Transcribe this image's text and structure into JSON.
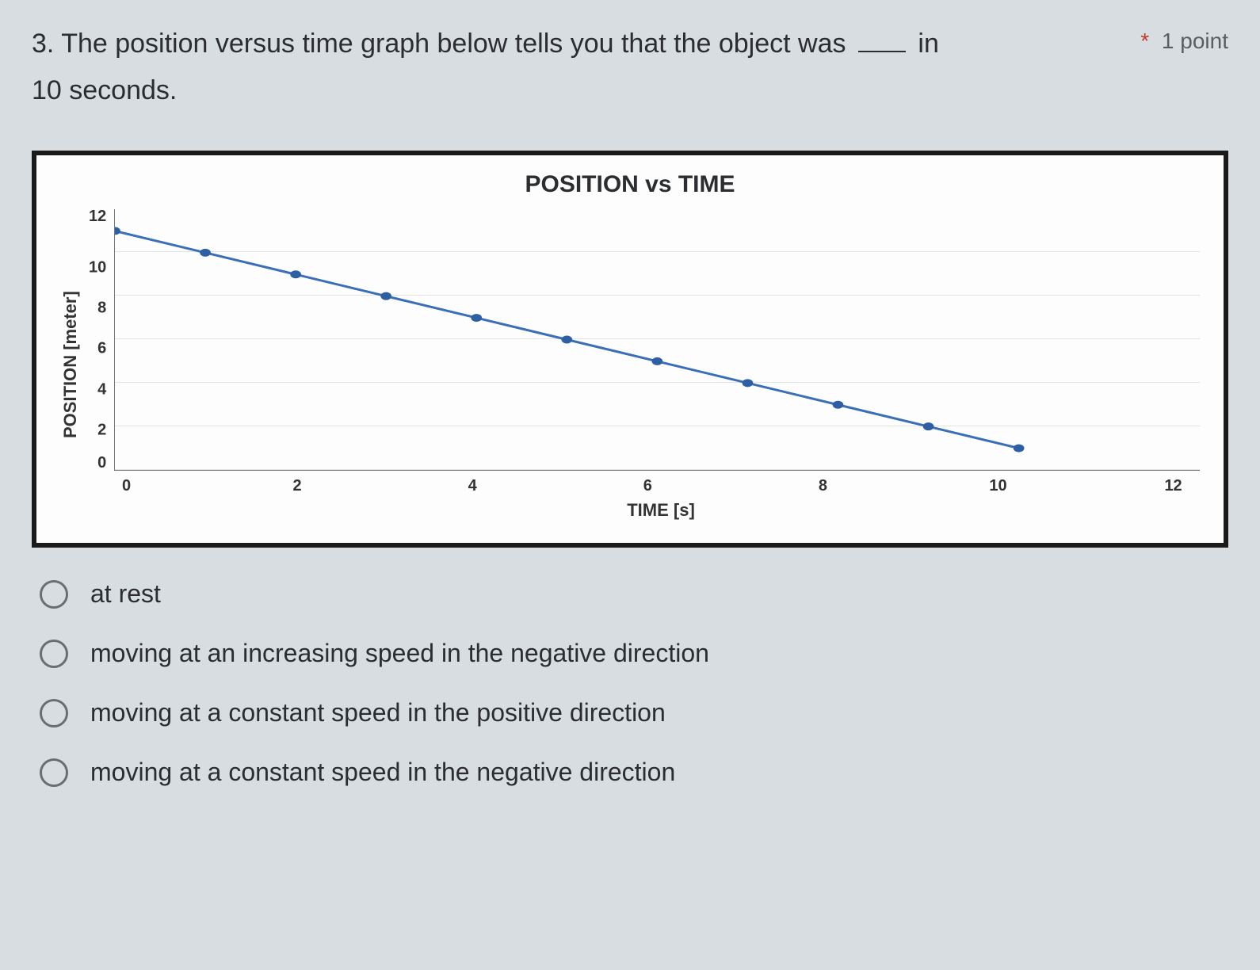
{
  "question": {
    "prefix": "3. The position versus time graph below tells you that the object was ",
    "suffix_before_meta": " in",
    "line2": "10 seconds."
  },
  "points": {
    "asterisk": "*",
    "label": "1 point"
  },
  "options": [
    {
      "label": "at rest"
    },
    {
      "label": "moving at an increasing speed in the negative direction"
    },
    {
      "label": "moving at a constant speed in the positive direction"
    },
    {
      "label": "moving at a constant speed in the negative direction"
    }
  ],
  "chart_data": {
    "type": "line",
    "title": "POSITION vs TIME",
    "xlabel": "TIME [s]",
    "ylabel": "POSITION [meter]",
    "x_ticks": [
      0,
      2,
      4,
      6,
      8,
      10,
      12
    ],
    "y_ticks": [
      0,
      2,
      4,
      6,
      8,
      10,
      12
    ],
    "xlim": [
      0,
      12
    ],
    "ylim": [
      0,
      12
    ],
    "series": [
      {
        "name": "position",
        "x": [
          0,
          1,
          2,
          3,
          4,
          5,
          6,
          7,
          8,
          9,
          10
        ],
        "y": [
          11,
          10,
          9,
          8,
          7,
          6,
          5,
          4,
          3,
          2,
          1
        ]
      }
    ]
  }
}
